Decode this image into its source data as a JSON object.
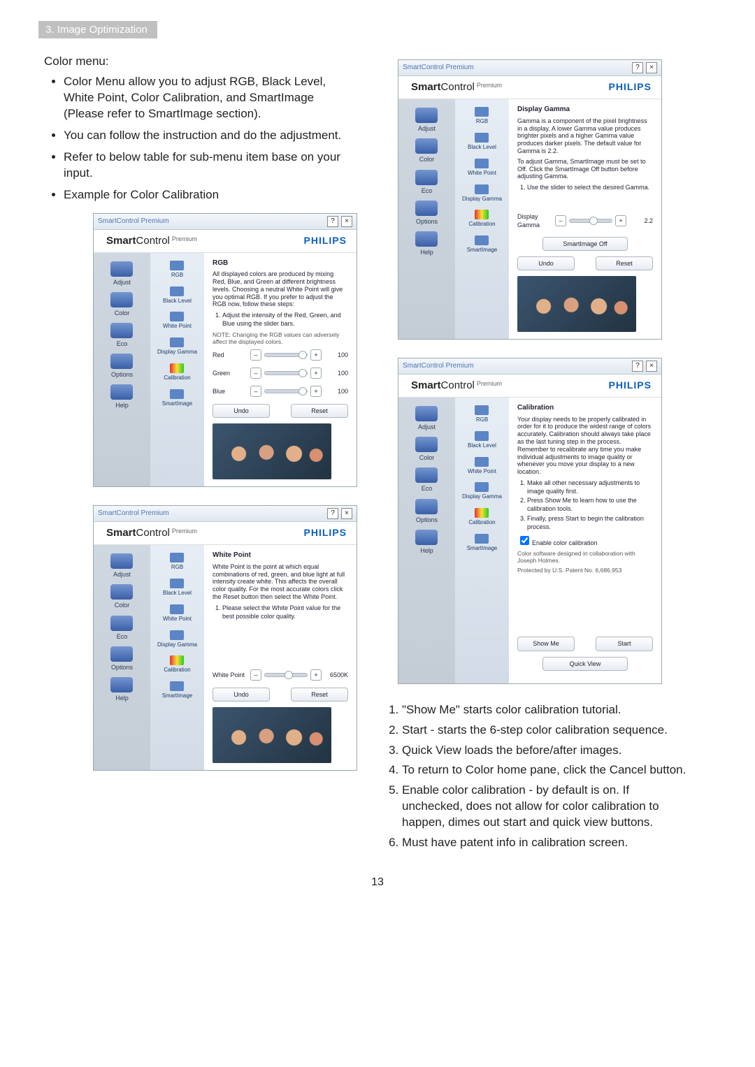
{
  "section_header": "3. Image Optimization",
  "colormenu_title": "Color menu:",
  "bullets": [
    "Color Menu allow you to adjust RGB, Black Level, White Point, Color Calibration, and SmartImage (Please refer to SmartImage section).",
    "You can follow the instruction and do the adjustment.",
    "Refer to below table for sub-menu item base on your input.",
    "Example for Color Calibration"
  ],
  "numbered": [
    "\"Show Me\" starts color calibration tutorial.",
    "Start - starts the 6-step color calibration sequence.",
    "Quick View loads the before/after images.",
    "To return to Color home pane, click the Cancel button.",
    "Enable color calibration - by default is on. If unchecked, does not allow for color calibration to happen, dimes out start and quick view buttons.",
    "Must have patent info in calibration screen."
  ],
  "page_no": "13",
  "common": {
    "window_title": "SmartControl Premium",
    "brand_smart": "Smart",
    "brand_control": "Control",
    "brand_premium": "Premium",
    "brand_philips": "PHILIPS",
    "side_items": [
      "Adjust",
      "Color",
      "Eco",
      "Options",
      "Help"
    ],
    "sub_items": [
      "RGB",
      "Black Level",
      "White Point",
      "Display Gamma",
      "Calibration",
      "SmartImage"
    ],
    "undo": "Undo",
    "reset": "Reset"
  },
  "rgb_panel": {
    "heading": "RGB",
    "para": "All displayed colors are produced by mixing Red, Blue, and Green at different brightness levels. Choosing a neutral White Point will give you optimal RGB. If you prefer to adjust the RGB now, follow these steps:",
    "step": "Adjust the intensity of the Red, Green, and Blue using the slider bars.",
    "note": "NOTE: Changing the RGB values can adversely affect the displayed colors.",
    "rows": [
      {
        "label": "Red",
        "value": "100"
      },
      {
        "label": "Green",
        "value": "100"
      },
      {
        "label": "Blue",
        "value": "100"
      }
    ]
  },
  "wp_panel": {
    "heading": "White Point",
    "para": "White Point is the point at which equal combinations of red, green, and blue light at full intensity create white. This affects the overall color quality. For the most accurate colors click the Reset button then select the White Point.",
    "step": "Please select the White Point value for the best possible color quality.",
    "label": "White Point",
    "value": "6500K"
  },
  "gamma_panel": {
    "heading": "Display Gamma",
    "para": "Gamma is a component of the pixel brightness in a display. A lower Gamma value produces brighter pixels and a higher Gamma value produces darker pixels. The default value for Gamma is 2.2.",
    "para2": "To adjust Gamma, SmartImage must be set to Off. Click the SmartImage Off button before adjusting Gamma.",
    "step": "Use the slider to select the desired Gamma.",
    "label": "Display Gamma",
    "value": "2.2",
    "off_btn": "SmartImage Off"
  },
  "cal_panel": {
    "heading": "Calibration",
    "para": "Your display needs to be properly calibrated in order for it to produce the widest range of colors accurately. Calibration should always take place as the last tuning step in the process. Remember to recalibrate any time you make individual adjustments to image quality or whenever you move your display to a new location.",
    "steps": [
      "Make all other necessary adjustments to image quality first.",
      "Press Show Me to learn how to use the calibration tools.",
      "Finally, press Start to begin the calibration process."
    ],
    "enable": "Enable color calibration",
    "credit": "Color software designed in collaboration with Joseph Holmes.",
    "patent": "Protected by U.S. Patent No. 6,686,953",
    "showme": "Show Me",
    "start": "Start",
    "quick": "Quick View"
  }
}
